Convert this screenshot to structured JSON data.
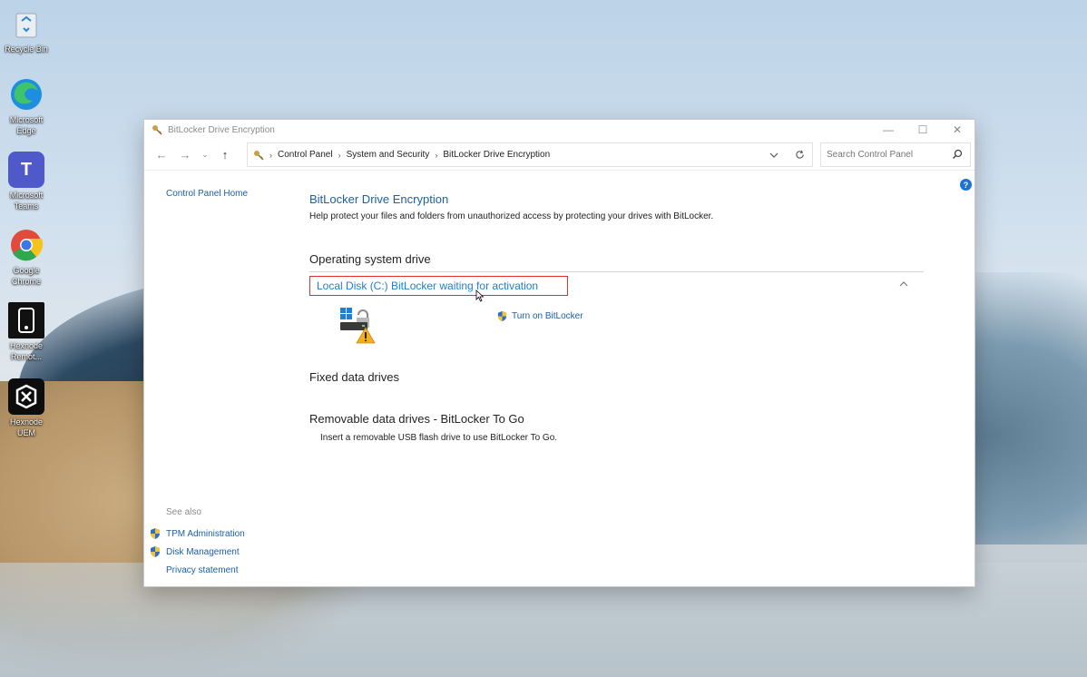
{
  "desktop": {
    "icons": [
      {
        "label": "Recycle Bin",
        "icon": "recycle-bin-icon"
      },
      {
        "label": "Microsoft Edge",
        "icon": "edge-icon"
      },
      {
        "label": "Microsoft Teams",
        "icon": "teams-icon"
      },
      {
        "label": "Google Chrome",
        "icon": "chrome-icon"
      },
      {
        "label": "Hexnode Remot...",
        "icon": "hexnode-remote-icon"
      },
      {
        "label": "Hexnode UEM",
        "icon": "hexnode-uem-icon"
      }
    ]
  },
  "window": {
    "title": "BitLocker Drive Encryption",
    "controls": {
      "minimize": "—",
      "maximize": "☐",
      "close": "✕"
    }
  },
  "navbar": {
    "back": "←",
    "forward": "→",
    "recent": "⌄",
    "up": "↑",
    "breadcrumb": [
      "Control Panel",
      "System and Security",
      "BitLocker Drive Encryption"
    ],
    "search_placeholder": "Search Control Panel"
  },
  "left_pane": {
    "home_link": "Control Panel Home",
    "see_also_header": "See also",
    "see_also": [
      "TPM Administration",
      "Disk Management",
      "Privacy statement"
    ]
  },
  "main": {
    "title": "BitLocker Drive Encryption",
    "description": "Help protect your files and folders from unauthorized access by protecting your drives with BitLocker.",
    "os_section": "Operating system drive",
    "drive_label": "Local Disk (C:) BitLocker waiting for activation",
    "turn_on": "Turn on BitLocker",
    "fixed_section": "Fixed data drives",
    "removable_section": "Removable data drives - BitLocker To Go",
    "removable_desc": "Insert a removable USB flash drive to use BitLocker To Go."
  },
  "colors": {
    "link": "#1c5fa6",
    "drive_link": "#1c7fd6",
    "highlight_border": "#e0312a"
  }
}
